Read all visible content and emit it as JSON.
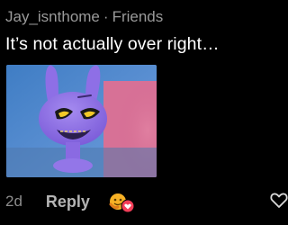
{
  "comment": {
    "username": "Jay_isnthome",
    "separator": "·",
    "relation": "Friends",
    "text": "It’s not actually over right…",
    "media_description_icon": "character-reaction-gif",
    "time": "2d",
    "reply_label": "Reply",
    "reaction_icons": [
      "care-emoji-icon",
      "heart-reaction-icon"
    ],
    "like_icon": "heart-outline-icon"
  },
  "colors": {
    "background": "#000000",
    "username": "#9a9a9a",
    "text": "#ffffff",
    "meta": "#8c8c8c",
    "reply": "#b4b4b4",
    "reaction_orange": "#f7b125",
    "reaction_red": "#f33e58"
  }
}
